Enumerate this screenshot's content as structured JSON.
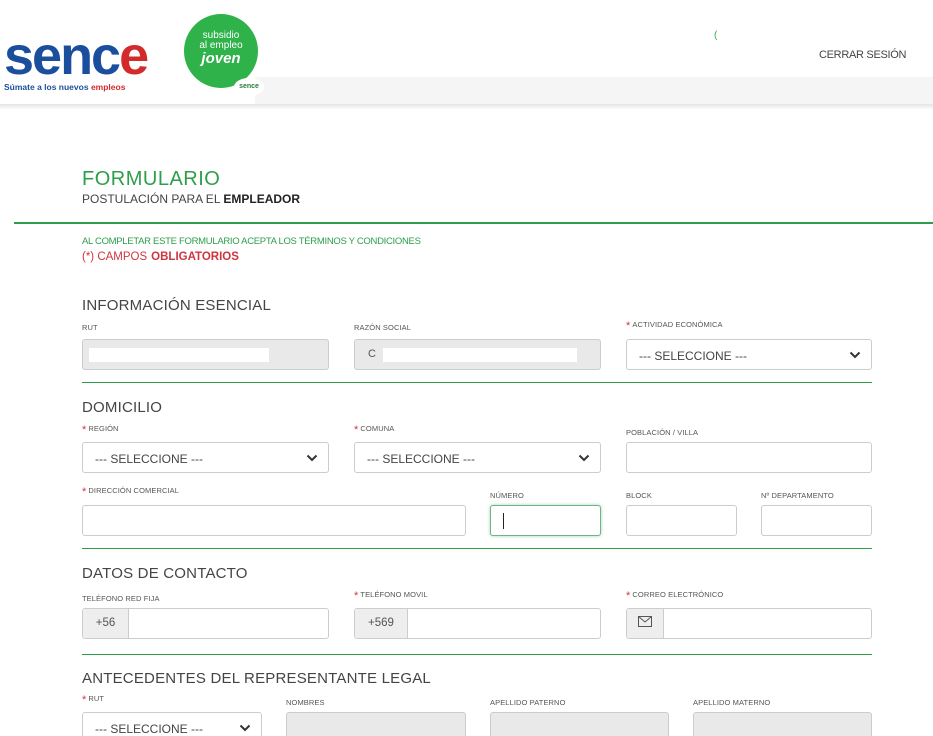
{
  "header": {
    "logo": {
      "brand": "sence",
      "tagline_prefix": "Súmate a los nuevos",
      "tagline_highlight": "empleos"
    },
    "badge": {
      "line1": "subsidio",
      "line2": "al empleo",
      "line3": "joven",
      "mini": "sence"
    },
    "mark": "(",
    "logout_label": "CERRAR SESIÓN"
  },
  "form": {
    "title": "FORMULARIO",
    "subtitle_prefix": "POSTULACIÓN PARA EL",
    "subtitle_bold": "EMPLEADOR",
    "terms": "AL COMPLETAR ESTE FORMULARIO ACEPTA LOS TÉRMINOS Y CONDICIONES",
    "required_prefix": "(*) CAMPOS",
    "required_bold": "OBLIGATORIOS"
  },
  "sections": {
    "esencial": {
      "title": "INFORMACIÓN ESENCIAL",
      "rut_label": "RUT",
      "razon_label": "RAZÓN SOCIAL",
      "razon_value": "C",
      "actividad_label": "ACTIVIDAD ECONÓMICA",
      "actividad_value": "--- SELECCIONE ---"
    },
    "domicilio": {
      "title": "DOMICILIO",
      "region_label": "REGIÓN",
      "region_value": "--- SELECCIONE ---",
      "comuna_label": "COMUNA",
      "comuna_value": "--- SELECCIONE ---",
      "poblacion_label": "POBLACIÓN / VILLA",
      "direccion_label": "DIRECCIÓN COMERCIAL",
      "numero_label": "NÚMERO",
      "block_label": "BLOCK",
      "depto_label": "Nº DEPARTAMENTO"
    },
    "contacto": {
      "title": "DATOS DE CONTACTO",
      "fijo_label": "TELÉFONO RED FIJA",
      "fijo_prefix": "+56",
      "movil_label": "TELÉFONO MOVIL",
      "movil_prefix": "+569",
      "correo_label": "CORREO ELECTRÓNICO"
    },
    "representante": {
      "title": "ANTECEDENTES DEL REPRESENTANTE LEGAL",
      "rut_label": "RUT",
      "rut_value": "--- SELECCIONE ---",
      "nombres_label": "NOMBRES",
      "paterno_label": "APELLIDO PATERNO",
      "materno_label": "APELLIDO MATERNO"
    }
  },
  "icons": {
    "chevron": "chevron-down-icon",
    "mail": "envelope-icon"
  },
  "colors": {
    "accent": "#2e9e4b",
    "required": "#d0343f",
    "brand_blue": "#1b4f9e"
  }
}
